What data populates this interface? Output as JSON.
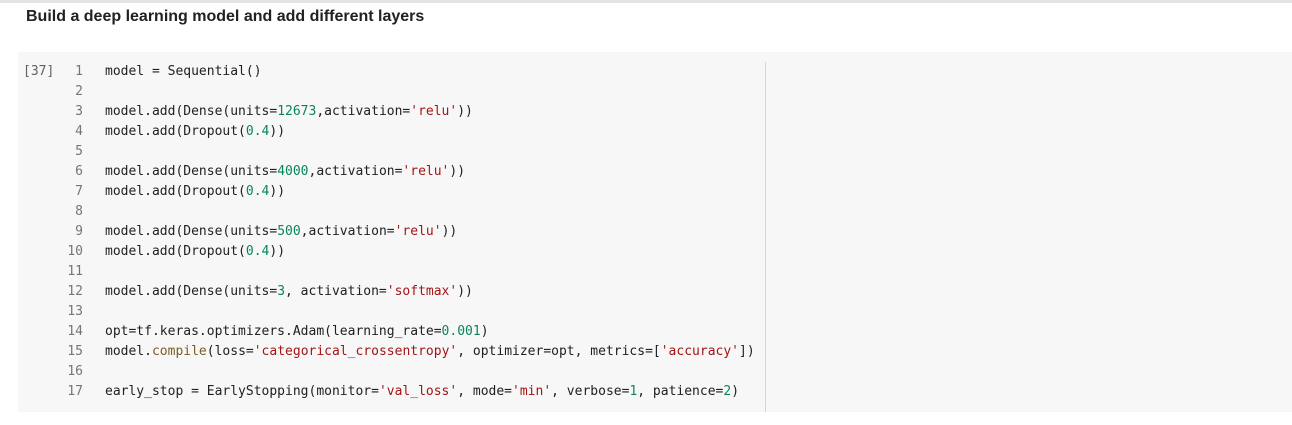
{
  "heading": "Build a deep learning model and add different layers",
  "cell": {
    "execution_count": "[37]",
    "lines": [
      {
        "n": "1",
        "tokens": [
          {
            "t": "model = Sequential()",
            "k": "plain"
          }
        ]
      },
      {
        "n": "2",
        "tokens": []
      },
      {
        "n": "3",
        "tokens": [
          {
            "t": "model.add(Dense(units=",
            "k": "plain"
          },
          {
            "t": "12673",
            "k": "num"
          },
          {
            "t": ",activation=",
            "k": "plain"
          },
          {
            "t": "'relu'",
            "k": "str"
          },
          {
            "t": "))",
            "k": "plain"
          }
        ]
      },
      {
        "n": "4",
        "tokens": [
          {
            "t": "model.add(Dropout(",
            "k": "plain"
          },
          {
            "t": "0.4",
            "k": "num"
          },
          {
            "t": "))",
            "k": "plain"
          }
        ]
      },
      {
        "n": "5",
        "tokens": []
      },
      {
        "n": "6",
        "tokens": [
          {
            "t": "model.add(Dense(units=",
            "k": "plain"
          },
          {
            "t": "4000",
            "k": "num"
          },
          {
            "t": ",activation=",
            "k": "plain"
          },
          {
            "t": "'relu'",
            "k": "str"
          },
          {
            "t": "))",
            "k": "plain"
          }
        ]
      },
      {
        "n": "7",
        "tokens": [
          {
            "t": "model.add(Dropout(",
            "k": "plain"
          },
          {
            "t": "0.4",
            "k": "num"
          },
          {
            "t": "))",
            "k": "plain"
          }
        ]
      },
      {
        "n": "8",
        "tokens": []
      },
      {
        "n": "9",
        "tokens": [
          {
            "t": "model.add(Dense(units=",
            "k": "plain"
          },
          {
            "t": "500",
            "k": "num"
          },
          {
            "t": ",activation=",
            "k": "plain"
          },
          {
            "t": "'relu'",
            "k": "str"
          },
          {
            "t": "))",
            "k": "plain"
          }
        ]
      },
      {
        "n": "10",
        "tokens": [
          {
            "t": "model.add(Dropout(",
            "k": "plain"
          },
          {
            "t": "0.4",
            "k": "num"
          },
          {
            "t": "))",
            "k": "plain"
          }
        ]
      },
      {
        "n": "11",
        "tokens": []
      },
      {
        "n": "12",
        "tokens": [
          {
            "t": "model.add(Dense(units=",
            "k": "plain"
          },
          {
            "t": "3",
            "k": "num"
          },
          {
            "t": ", activation=",
            "k": "plain"
          },
          {
            "t": "'softmax'",
            "k": "str"
          },
          {
            "t": "))",
            "k": "plain"
          }
        ]
      },
      {
        "n": "13",
        "tokens": []
      },
      {
        "n": "14",
        "tokens": [
          {
            "t": "opt=tf.keras.optimizers.Adam(learning_rate=",
            "k": "plain"
          },
          {
            "t": "0.001",
            "k": "num"
          },
          {
            "t": ")",
            "k": "plain"
          }
        ]
      },
      {
        "n": "15",
        "tokens": [
          {
            "t": "model.",
            "k": "plain"
          },
          {
            "t": "compile",
            "k": "kw"
          },
          {
            "t": "(loss=",
            "k": "plain"
          },
          {
            "t": "'categorical_crossentropy'",
            "k": "str"
          },
          {
            "t": ", optimizer=opt, metrics=[",
            "k": "plain"
          },
          {
            "t": "'accuracy'",
            "k": "str"
          },
          {
            "t": "])",
            "k": "plain"
          }
        ]
      },
      {
        "n": "16",
        "tokens": []
      },
      {
        "n": "17",
        "tokens": [
          {
            "t": "early_stop = EarlyStopping(monitor=",
            "k": "plain"
          },
          {
            "t": "'val_loss'",
            "k": "str"
          },
          {
            "t": ", mode=",
            "k": "plain"
          },
          {
            "t": "'min'",
            "k": "str"
          },
          {
            "t": ", verbose=",
            "k": "plain"
          },
          {
            "t": "1",
            "k": "num"
          },
          {
            "t": ", patience=",
            "k": "plain"
          },
          {
            "t": "2",
            "k": "num"
          },
          {
            "t": ")",
            "k": "plain"
          }
        ]
      }
    ]
  }
}
